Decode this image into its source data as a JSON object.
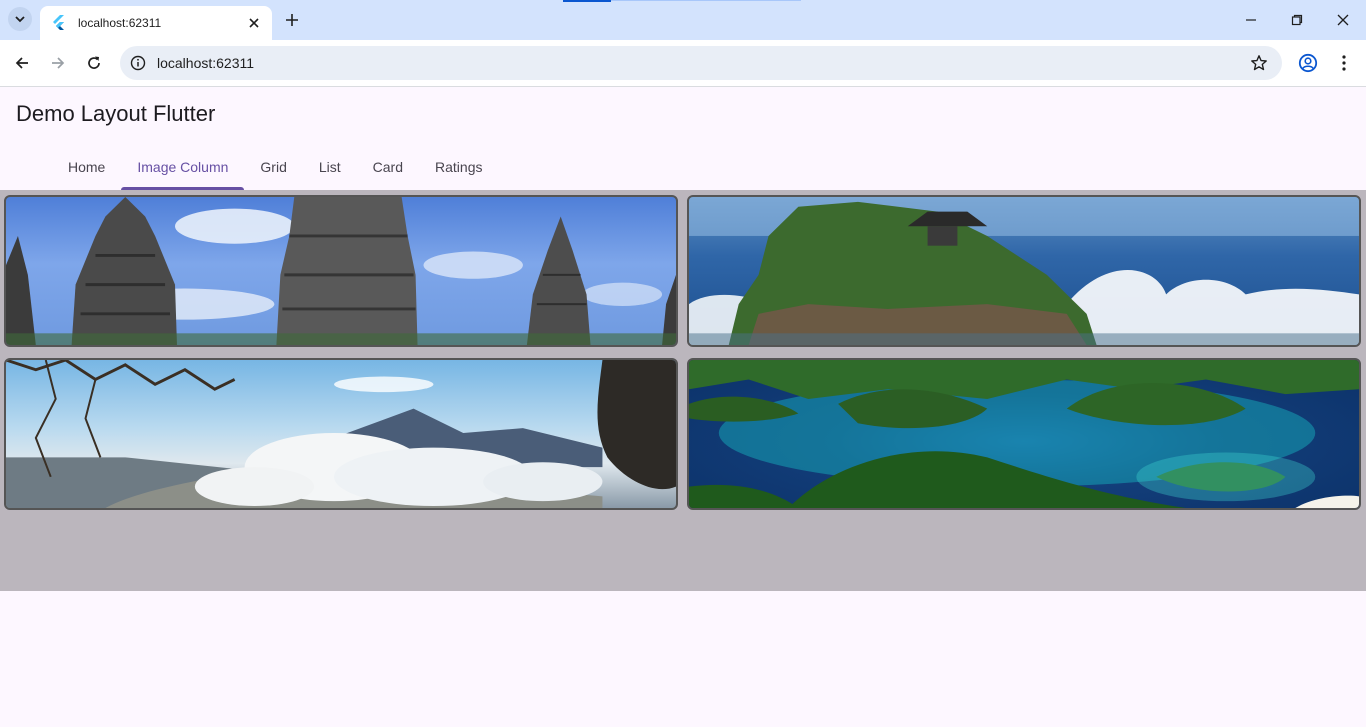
{
  "browser": {
    "tab_title": "localhost:62311",
    "url": "localhost:62311",
    "icons": [
      "tab-search-icon",
      "flutter-favicon",
      "close-icon",
      "plus-icon",
      "minimize-icon",
      "restore-icon",
      "close-window-icon",
      "back-icon",
      "forward-icon",
      "reload-icon",
      "info-icon",
      "star-icon",
      "profile-icon",
      "menu-icon"
    ]
  },
  "app": {
    "title": "Demo Layout Flutter",
    "tabs": [
      {
        "label": "Home"
      },
      {
        "label": "Image Column"
      },
      {
        "label": "Grid"
      },
      {
        "label": "List"
      },
      {
        "label": "Card"
      },
      {
        "label": "Ratings"
      }
    ],
    "active_tab": "Image Column",
    "accent_color": "#6750a4"
  }
}
